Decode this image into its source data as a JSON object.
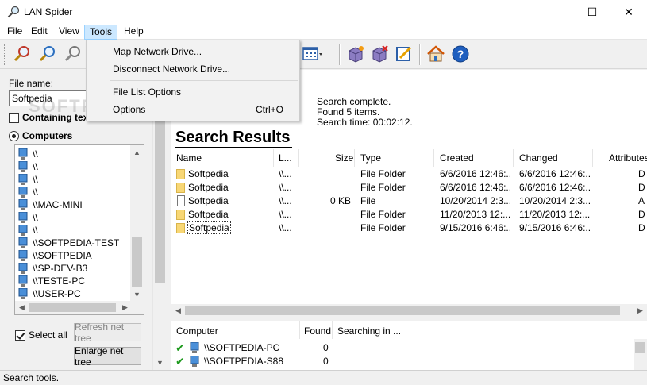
{
  "window": {
    "title": "LAN Spider",
    "min": "—",
    "max": "☐",
    "close": "✕"
  },
  "menu": [
    "File",
    "Edit",
    "View",
    "Tools",
    "Help"
  ],
  "tools_menu": {
    "items": [
      {
        "label": "Map Network Drive...",
        "shortcut": ""
      },
      {
        "label": "Disconnect Network Drive...",
        "shortcut": ""
      },
      {
        "label": "File List Options",
        "shortcut": ""
      },
      {
        "label": "Options",
        "shortcut": "Ctrl+O"
      }
    ]
  },
  "left": {
    "file_name_label": "File name:",
    "file_name_value": "Softpedia",
    "containing_text_label": "Containing text",
    "computers_label": "Computers",
    "tree_items": [
      "\\\\",
      "\\\\",
      "\\\\",
      "\\\\",
      "\\\\MAC-MINI",
      "\\\\",
      "\\\\",
      "\\\\SOFTPEDIA-TEST",
      "\\\\SOFTPEDIA",
      "\\\\SP-DEV-B3",
      "\\\\TESTE-PC",
      "\\\\USER-PC"
    ],
    "select_all_label": "Select all",
    "refresh_label": "Refresh net tree",
    "enlarge_label": "Enlarge net tree"
  },
  "search": {
    "status_line1": "Search complete.",
    "status_line2": "Found 5 items.",
    "status_line3": "Search time: 00:02:12.",
    "results_title": "Search Results"
  },
  "columns": {
    "name": "Name",
    "location": "L...",
    "size": "Size",
    "type": "Type",
    "created": "Created",
    "changed": "Changed",
    "attributes": "Attributes"
  },
  "rows": [
    {
      "name": "Softpedia",
      "location": "\\\\...",
      "size": "",
      "type": "File Folder",
      "created": "6/6/2016 12:46:...",
      "changed": "6/6/2016 12:46:...",
      "attr": "D",
      "kind": "folder"
    },
    {
      "name": "Softpedia",
      "location": "\\\\...",
      "size": "",
      "type": "File Folder",
      "created": "6/6/2016 12:46:...",
      "changed": "6/6/2016 12:46:...",
      "attr": "D",
      "kind": "folder"
    },
    {
      "name": "Softpedia",
      "location": "\\\\...",
      "size": "0 KB",
      "type": "File",
      "created": "10/20/2014 2:3...",
      "changed": "10/20/2014 2:3...",
      "attr": "A",
      "kind": "file"
    },
    {
      "name": "Softpedia",
      "location": "\\\\...",
      "size": "",
      "type": "File Folder",
      "created": "11/20/2013 12:...",
      "changed": "11/20/2013 12:...",
      "attr": "D",
      "kind": "folder"
    },
    {
      "name": "Softpedia",
      "location": "\\\\...",
      "size": "",
      "type": "File Folder",
      "created": "9/15/2016 6:46:...",
      "changed": "9/15/2016 6:46:...",
      "attr": "D",
      "kind": "folder"
    }
  ],
  "lower": {
    "col_computer": "Computer",
    "col_found": "Found",
    "col_searching": "Searching in ...",
    "rows": [
      {
        "computer": "\\\\SOFTPEDIA-PC",
        "found": "0"
      },
      {
        "computer": "\\\\SOFTPEDIA-S88",
        "found": "0"
      }
    ]
  },
  "statusbar": "Search tools.",
  "watermark": "SOFTPEDIA",
  "icons": [
    "app-magnifier-icon",
    "search-icon",
    "search-stop-icon",
    "view-icon",
    "cube-add-icon",
    "cube-delete-icon",
    "edit-icon",
    "home-icon",
    "help-icon"
  ],
  "colors": {
    "menu_active": "#cce8ff",
    "folder": "#f8d775",
    "check": "#1e9a1e",
    "help_blue": "#1f5fbf"
  }
}
